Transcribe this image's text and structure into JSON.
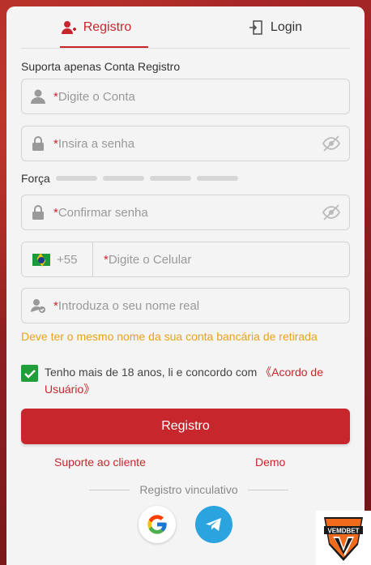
{
  "tabs": {
    "registro": "Registro",
    "login": "Login"
  },
  "notice": "Suporta apenas Conta Registro",
  "fields": {
    "account": {
      "req": "*",
      "placeholder": "Digite o Conta"
    },
    "password": {
      "req": "*",
      "placeholder": "Insira a senha"
    },
    "confirm": {
      "req": "*",
      "placeholder": "Confirmar senha"
    },
    "phone": {
      "prefix": "+55",
      "req": "*",
      "placeholder": "Digite o Celular"
    },
    "realname": {
      "req": "*",
      "placeholder": "Introduza o seu nome real"
    }
  },
  "strength": {
    "label": "Força",
    "level": 0
  },
  "hint": "Deve ter o mesmo nome da sua conta bancária de retirada",
  "agree": {
    "text": "Tenho mais de 18 anos, li e concordo com ",
    "link": "《Acordo de Usuário》",
    "checked": true
  },
  "submit": "Registro",
  "links": {
    "support": "Suporte ao cliente",
    "demo": "Demo"
  },
  "divider": "Registro vinculativo",
  "social": [
    "google-icon",
    "telegram-icon"
  ],
  "logo": {
    "text": "VEMDBET"
  },
  "colors": {
    "accent": "#c8262d",
    "check": "#1f9e3a",
    "hint": "#e8a21a"
  }
}
